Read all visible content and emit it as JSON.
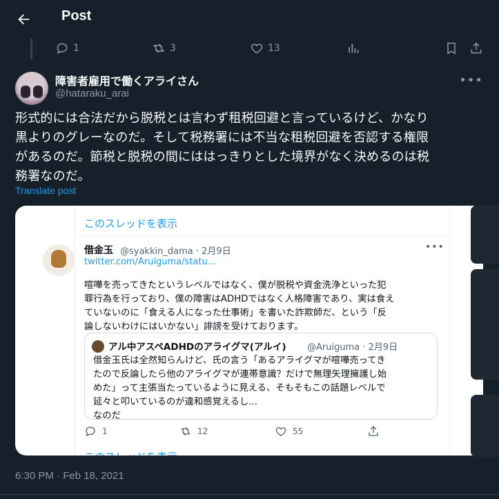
{
  "header": {
    "title": "Post"
  },
  "top_actions": {
    "replies": "1",
    "reposts": "3",
    "likes": "13"
  },
  "author": {
    "name": "障害者雇用で働くアライさん",
    "handle": "@hataraku_arai"
  },
  "post": {
    "text_lines": [
      "形式的には合法だから脱税とは言わず租税回避と言っているけど、かなり",
      "黒よりのグレーなのだ。そして税務署には不当な租税回避を否認する権限",
      "があるのだ。節税と脱税の間にははっきりとした境界がなく決めるのは税",
      "務署なのだ。"
    ],
    "translate": "Translate post",
    "timestamp": "6:30 PM · Feb 18, 2021"
  },
  "embed": {
    "show_thread": "このスレッドを表示",
    "name": "借金玉",
    "handle": "@syakkin_dama · 2月9日",
    "link": "twitter.com/Aruiguma/statu...",
    "text_lines": [
      "喧嘩を売ってきたというレベルではなく、僕が脱税や資金洗浄といった犯",
      "罪行為を行っており、僕の障害はADHDではなく人格障害であり、実は食え",
      "ていないのに「食える人になった仕事術」を書いた詐欺師だ、という「反",
      "論しないわけにはいかない」誹謗を受けております。"
    ],
    "quote": {
      "name": "アル中アスペADHDのアライグマ(アルイ)",
      "handle": "@Aruiguma · 2月9日",
      "text_lines": [
        "借金玉氏は全然知らんけど、氏の言う「あるアライグマが喧嘩売ってき",
        "たので反論したら他のアライグマが連帯意識？だけで無理矢理擁護し始",
        "めた」って主張当たっているように見える、そもそもこの話題レベルで",
        "延々と叩いているのが違和感覚えるし...",
        "なのだ"
      ]
    },
    "actions": {
      "replies": "1",
      "reposts": "12",
      "likes": "55"
    }
  }
}
